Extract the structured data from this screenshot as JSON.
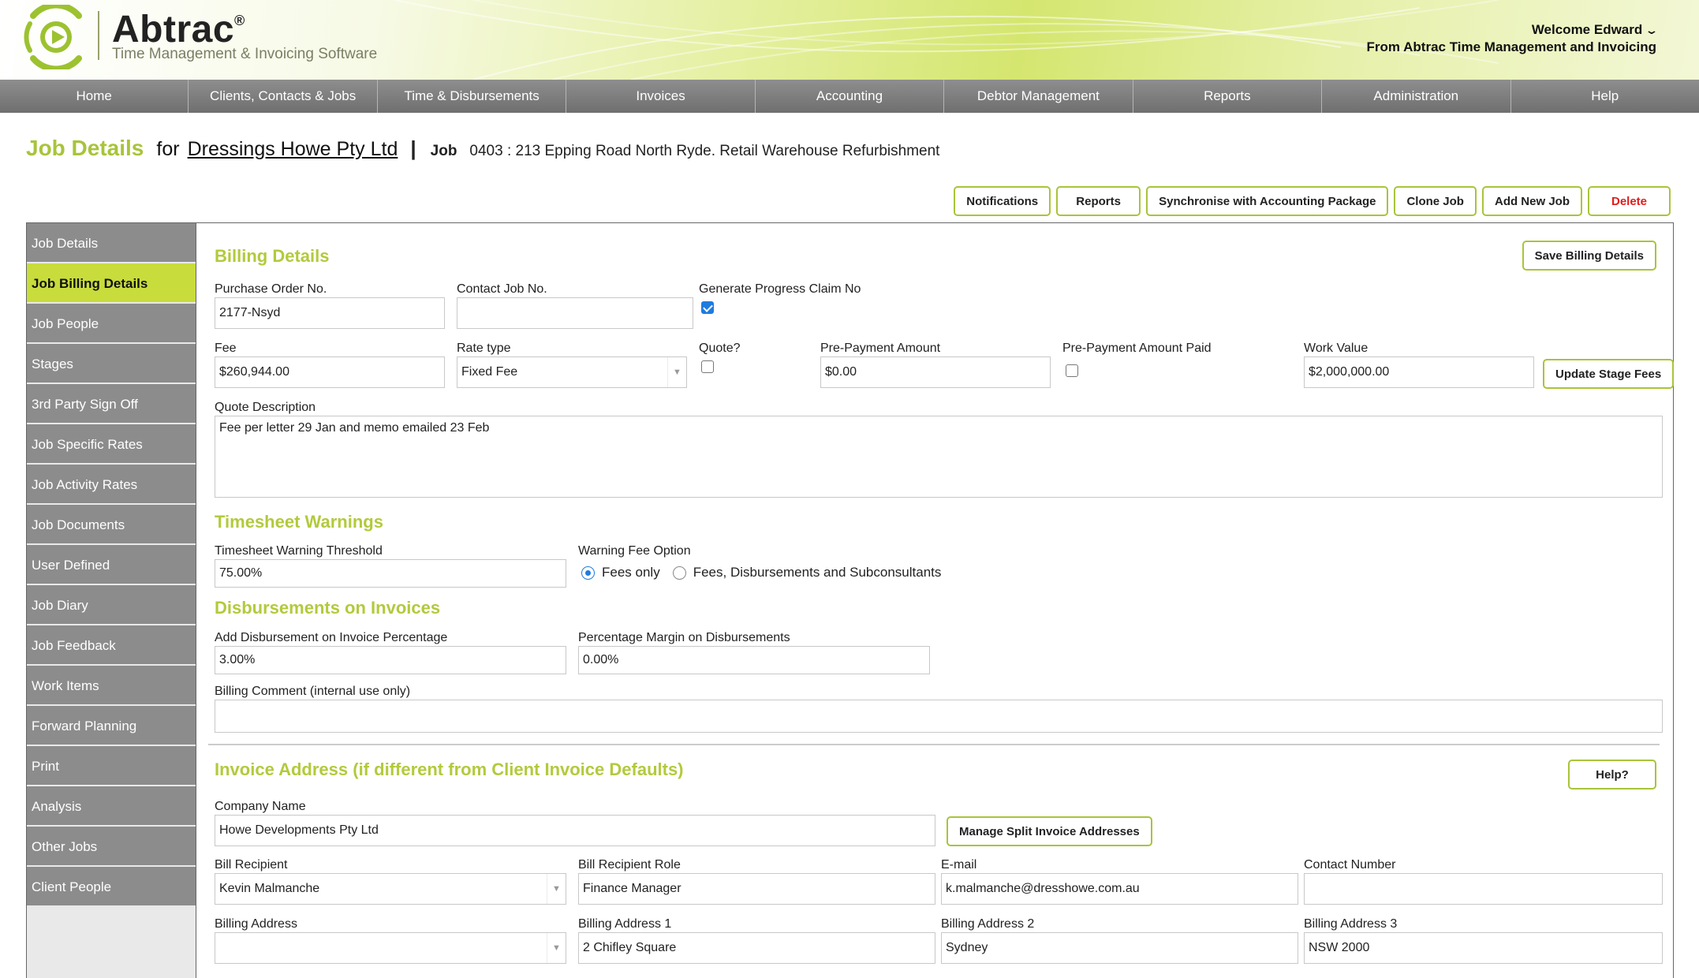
{
  "header": {
    "brand": "Abtrac",
    "brand_mark": "®",
    "tagline": "Time Management & Invoicing Software",
    "welcome": "Welcome Edward",
    "welcome_sub": "From Abtrac Time Management and Invoicing",
    "logo_icon": "abtrac-logo-icon",
    "accent_color": "#a8c43a"
  },
  "nav": {
    "items": [
      "Home",
      "Clients, Contacts & Jobs",
      "Time & Disbursements",
      "Invoices",
      "Accounting",
      "Debtor Management",
      "Reports",
      "Administration",
      "Help"
    ]
  },
  "title": {
    "page_title": "Job Details",
    "for_label": "for",
    "client": "Dressings Howe Pty Ltd",
    "separator": "|",
    "job_label": "Job",
    "job_value": "0403 : 213 Epping Road North Ryde. Retail Warehouse Refurbishment"
  },
  "actions": {
    "notifications": "Notifications",
    "reports": "Reports",
    "sync": "Synchronise with Accounting Package",
    "clone": "Clone Job",
    "add_new": "Add New Job",
    "delete": "Delete"
  },
  "sidebar": {
    "items": [
      "Job Details",
      "Job Billing Details",
      "Job People",
      "Stages",
      "3rd Party Sign Off",
      "Job Specific Rates",
      "Job Activity Rates",
      "Job Documents",
      "User Defined",
      "Job Diary",
      "Job Feedback",
      "Work Items",
      "Forward Planning",
      "Print",
      "Analysis",
      "Other Jobs",
      "Client People"
    ],
    "active": "Job Billing Details"
  },
  "billing": {
    "title": "Billing Details",
    "save_button": "Save Billing Details",
    "po_label": "Purchase Order No.",
    "po_value": "2177-Nsyd",
    "contact_job_label": "Contact Job No.",
    "contact_job_value": "",
    "progress_claim_label": "Generate Progress Claim No",
    "progress_claim_checked": true,
    "fee_label": "Fee",
    "fee_value": "$260,944.00",
    "rate_type_label": "Rate type",
    "rate_type_value": "Fixed Fee",
    "quote_label": "Quote?",
    "quote_checked": false,
    "prepay_label": "Pre-Payment Amount",
    "prepay_value": "$0.00",
    "prepay_paid_label": "Pre-Payment Amount Paid",
    "prepay_paid_checked": false,
    "work_value_label": "Work Value",
    "work_value": "$2,000,000.00",
    "update_stage_button": "Update Stage Fees",
    "quote_desc_label": "Quote Description",
    "quote_desc_value": "Fee per letter 29 Jan and memo emailed 23 Feb"
  },
  "timesheet": {
    "title": "Timesheet Warnings",
    "threshold_label": "Timesheet Warning Threshold",
    "threshold_value": "75.00%",
    "fee_option_label": "Warning Fee Option",
    "option_fees_only": "Fees only",
    "option_fees_all": "Fees, Disbursements and Subconsultants",
    "selected": "Fees only"
  },
  "disbursements": {
    "title": "Disbursements on Invoices",
    "add_pct_label": "Add Disbursement on Invoice Percentage",
    "add_pct_value": "3.00%",
    "margin_label": "Percentage Margin on Disbursements",
    "margin_value": "0.00%",
    "comment_label": "Billing Comment (internal use only)",
    "comment_value": ""
  },
  "invoice_address": {
    "title": "Invoice Address (if different from Client Invoice Defaults)",
    "help_button": "Help?",
    "company_label": "Company Name",
    "company_value": "Howe Developments Pty Ltd",
    "split_button": "Manage Split Invoice Addresses",
    "recipient_label": "Bill Recipient",
    "recipient_value": "Kevin Malmanche",
    "role_label": "Bill Recipient Role",
    "role_value": "Finance Manager",
    "email_label": "E-mail",
    "email_value": "k.malmanche@dresshowe.com.au",
    "contact_label": "Contact Number",
    "contact_value": "",
    "address_label": "Billing Address",
    "address_value": "",
    "address1_label": "Billing Address 1",
    "address1_value": "2 Chifley Square",
    "address2_label": "Billing Address 2",
    "address2_value": "Sydney",
    "address3_label": "Billing Address 3",
    "address3_value": "NSW 2000"
  }
}
